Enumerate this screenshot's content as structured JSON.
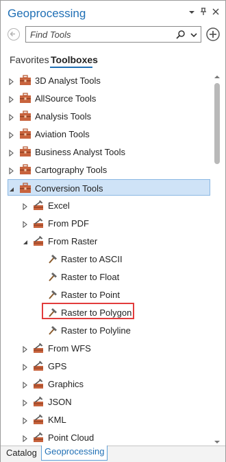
{
  "header": {
    "title": "Geoprocessing",
    "ctrl_dropdown": "▾",
    "ctrl_pin": "📌",
    "ctrl_close": "✕"
  },
  "search": {
    "placeholder": "Find Tools",
    "value": ""
  },
  "tabs": [
    {
      "label": "Favorites",
      "active": false
    },
    {
      "label": "Toolboxes",
      "active": true
    }
  ],
  "tree": [
    {
      "label": "3D Analyst Tools",
      "level": 0,
      "icon": "toolbox-icon",
      "expander": "collapsed"
    },
    {
      "label": "AllSource Tools",
      "level": 0,
      "icon": "toolbox-icon",
      "expander": "collapsed"
    },
    {
      "label": "Analysis Tools",
      "level": 0,
      "icon": "toolbox-icon",
      "expander": "collapsed"
    },
    {
      "label": "Aviation Tools",
      "level": 0,
      "icon": "toolbox-icon",
      "expander": "collapsed"
    },
    {
      "label": "Business Analyst Tools",
      "level": 0,
      "icon": "toolbox-icon",
      "expander": "collapsed"
    },
    {
      "label": "Cartography Tools",
      "level": 0,
      "icon": "toolbox-icon",
      "expander": "collapsed"
    },
    {
      "label": "Conversion Tools",
      "level": 0,
      "icon": "toolbox-icon",
      "expander": "expanded",
      "selected": true
    },
    {
      "label": "Excel",
      "level": 1,
      "icon": "toolset-icon",
      "expander": "collapsed"
    },
    {
      "label": "From PDF",
      "level": 1,
      "icon": "toolset-icon",
      "expander": "collapsed"
    },
    {
      "label": "From Raster",
      "level": 1,
      "icon": "toolset-icon",
      "expander": "expanded"
    },
    {
      "label": "Raster to ASCII",
      "level": 2,
      "icon": "hammer-icon",
      "expander": "none"
    },
    {
      "label": "Raster to Float",
      "level": 2,
      "icon": "hammer-icon",
      "expander": "none"
    },
    {
      "label": "Raster to Point",
      "level": 2,
      "icon": "hammer-icon",
      "expander": "none"
    },
    {
      "label": "Raster to Polygon",
      "level": 2,
      "icon": "hammer-icon",
      "expander": "none",
      "highlighted": true
    },
    {
      "label": "Raster to Polyline",
      "level": 2,
      "icon": "hammer-icon",
      "expander": "none"
    },
    {
      "label": "From WFS",
      "level": 1,
      "icon": "toolset-icon",
      "expander": "collapsed"
    },
    {
      "label": "GPS",
      "level": 1,
      "icon": "toolset-icon",
      "expander": "collapsed"
    },
    {
      "label": "Graphics",
      "level": 1,
      "icon": "toolset-icon",
      "expander": "collapsed"
    },
    {
      "label": "JSON",
      "level": 1,
      "icon": "toolset-icon",
      "expander": "collapsed"
    },
    {
      "label": "KML",
      "level": 1,
      "icon": "toolset-icon",
      "expander": "collapsed"
    },
    {
      "label": "Point Cloud",
      "level": 1,
      "icon": "toolset-icon",
      "expander": "collapsed"
    }
  ],
  "bottom_tabs": [
    {
      "label": "Catalog",
      "active": false
    },
    {
      "label": "Geoprocessing",
      "active": true
    }
  ],
  "colors": {
    "accent": "#1f6fb5",
    "selection": "#cfe3f7",
    "highlight_border": "#e23c3c",
    "toolbox": "#c8633d"
  }
}
